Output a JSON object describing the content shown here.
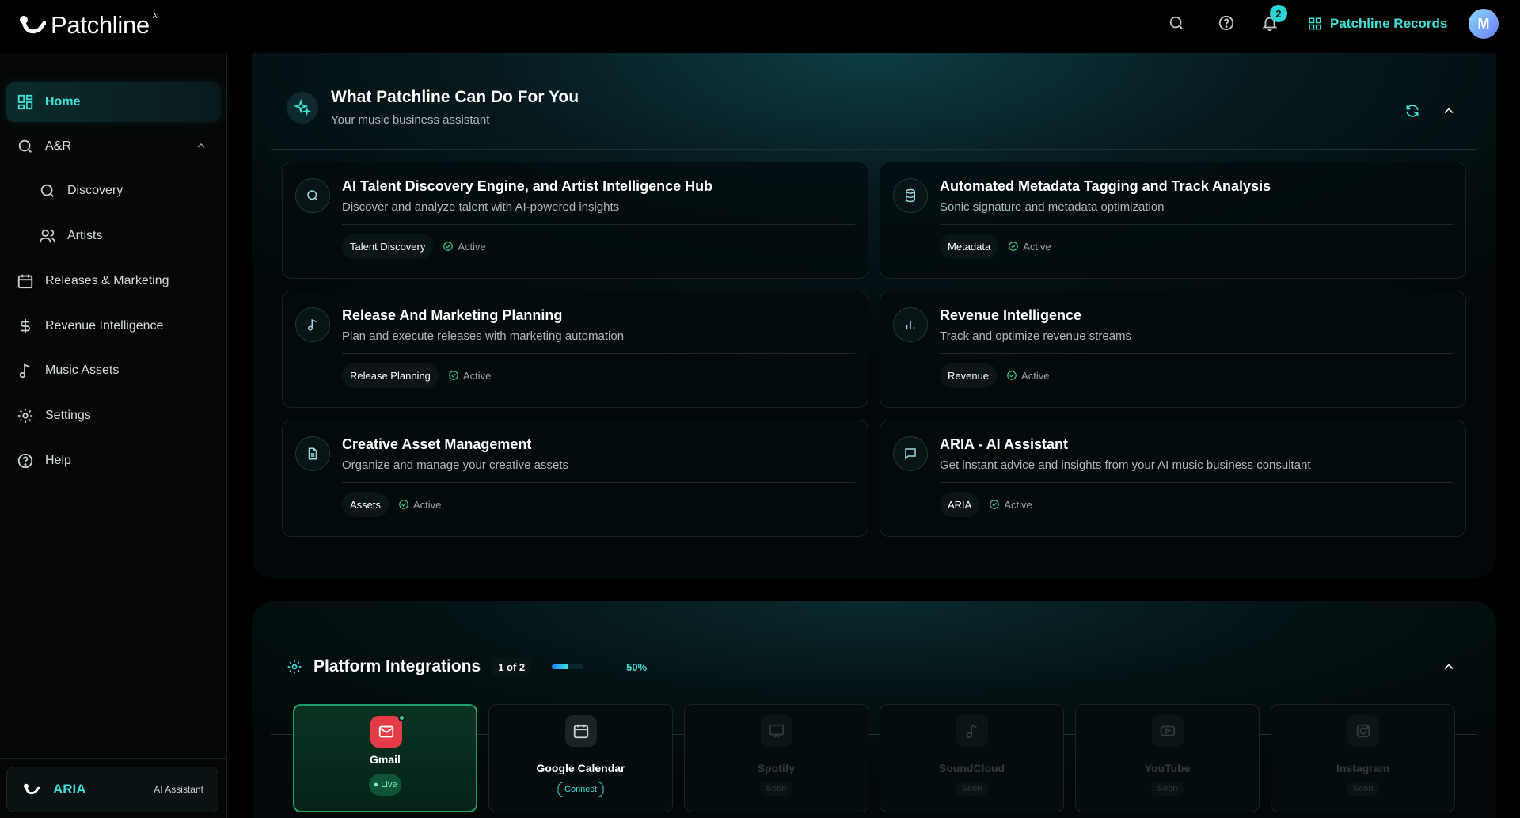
{
  "brand": {
    "name": "Patchline",
    "sup": "AI"
  },
  "topbar": {
    "notifications": "2",
    "workspace": "Patchline Records",
    "avatar": "M"
  },
  "sidebar": {
    "items": [
      {
        "label": "Home"
      },
      {
        "label": "A&R"
      },
      {
        "label": "Discovery"
      },
      {
        "label": "Artists"
      },
      {
        "label": "Releases & Marketing"
      },
      {
        "label": "Revenue Intelligence"
      },
      {
        "label": "Music Assets"
      },
      {
        "label": "Settings"
      },
      {
        "label": "Help"
      }
    ],
    "aria": {
      "name": "ARIA",
      "subtitle": "AI Assistant"
    }
  },
  "capabilities": {
    "title": "What Patchline Can Do For You",
    "subtitle": "Your music business assistant",
    "cards": [
      {
        "title": "AI Talent Discovery Engine, and Artist Intelligence Hub",
        "desc": "Discover and analyze talent with AI-powered insights",
        "tag": "Talent Discovery",
        "status": "Active"
      },
      {
        "title": "Automated Metadata Tagging and Track Analysis",
        "desc": "Sonic signature and metadata optimization",
        "tag": "Metadata",
        "status": "Active"
      },
      {
        "title": "Release And Marketing Planning",
        "desc": "Plan and execute releases with marketing automation",
        "tag": "Release Planning",
        "status": "Active"
      },
      {
        "title": "Revenue Intelligence",
        "desc": "Track and optimize revenue streams",
        "tag": "Revenue",
        "status": "Active"
      },
      {
        "title": "Creative Asset Management",
        "desc": "Organize and manage your creative assets",
        "tag": "Assets",
        "status": "Active"
      },
      {
        "title": "ARIA - AI Assistant",
        "desc": "Get instant advice and insights from your AI music business consultant",
        "tag": "ARIA",
        "status": "Active"
      }
    ]
  },
  "integrations": {
    "title": "Platform Integrations",
    "count": "1 of 2",
    "progress": 0.5,
    "percent": "50%",
    "items": [
      {
        "name": "Gmail",
        "status": "Live"
      },
      {
        "name": "Google Calendar",
        "status": "Connect"
      },
      {
        "name": "Spotify",
        "status": "Soon"
      },
      {
        "name": "SoundCloud",
        "status": "Soon"
      },
      {
        "name": "YouTube",
        "status": "Soon"
      },
      {
        "name": "Instagram",
        "status": "Soon"
      }
    ]
  },
  "colors": {
    "accent": "#3fe0d8",
    "success": "#3fc989",
    "gmail": "#e53b46"
  }
}
